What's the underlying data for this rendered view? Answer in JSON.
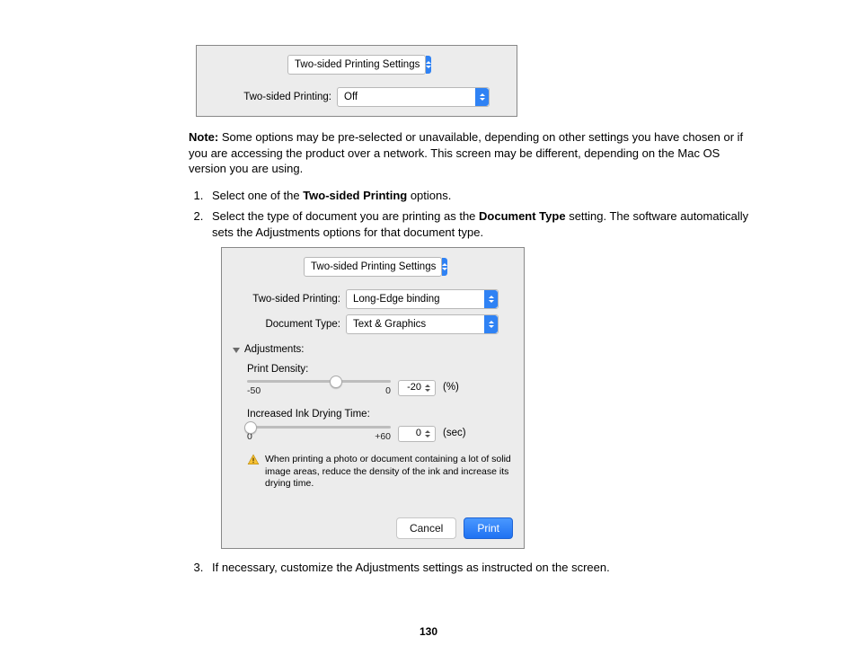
{
  "pane1": {
    "menu": "Two-sided Printing Settings",
    "row": {
      "label": "Two-sided Printing:",
      "value": "Off"
    }
  },
  "note": {
    "label": "Note:",
    "text": " Some options may be pre-selected or unavailable, depending on other settings you have chosen or if you are accessing the product over a network. This screen may be different, depending on the Mac OS version you are using."
  },
  "steps": {
    "s1a": "Select one of the ",
    "s1b": "Two-sided Printing",
    "s1c": " options.",
    "s2a": "Select the type of document you are printing as the ",
    "s2b": "Document Type",
    "s2c": " setting. The software automatically sets the Adjustments options for that document type.",
    "s3": "If necessary, customize the Adjustments settings as instructed on the screen."
  },
  "pane2": {
    "menu": "Two-sided Printing Settings",
    "row1": {
      "label": "Two-sided Printing:",
      "value": "Long-Edge binding"
    },
    "row2": {
      "label": "Document Type:",
      "value": "Text & Graphics"
    },
    "adjustments": "Adjustments:",
    "density": {
      "label": "Print Density:",
      "value": "-20",
      "unit": "(%)",
      "min": "-50",
      "max": "0"
    },
    "drytime": {
      "label": "Increased Ink Drying Time:",
      "value": "0",
      "unit": "(sec)",
      "min": "0",
      "max": "+60"
    },
    "warning": "When printing a photo or document containing a lot of solid image areas, reduce the density of the ink and increase its drying time.",
    "cancel": "Cancel",
    "print": "Print"
  },
  "pagenum": "130"
}
